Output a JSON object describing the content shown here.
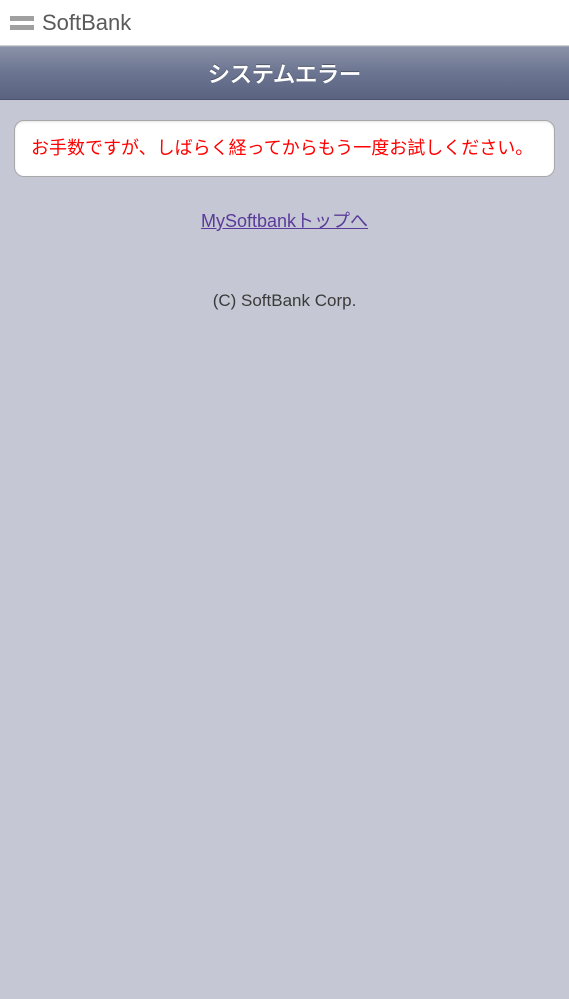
{
  "header": {
    "brand": "SoftBank"
  },
  "titleBar": {
    "title": "システムエラー"
  },
  "errorBox": {
    "message": "お手数ですが、しばらく経ってからもう一度お試しください。"
  },
  "link": {
    "label": "MySoftbankトップへ"
  },
  "footer": {
    "copyright": "(C) SoftBank Corp."
  }
}
